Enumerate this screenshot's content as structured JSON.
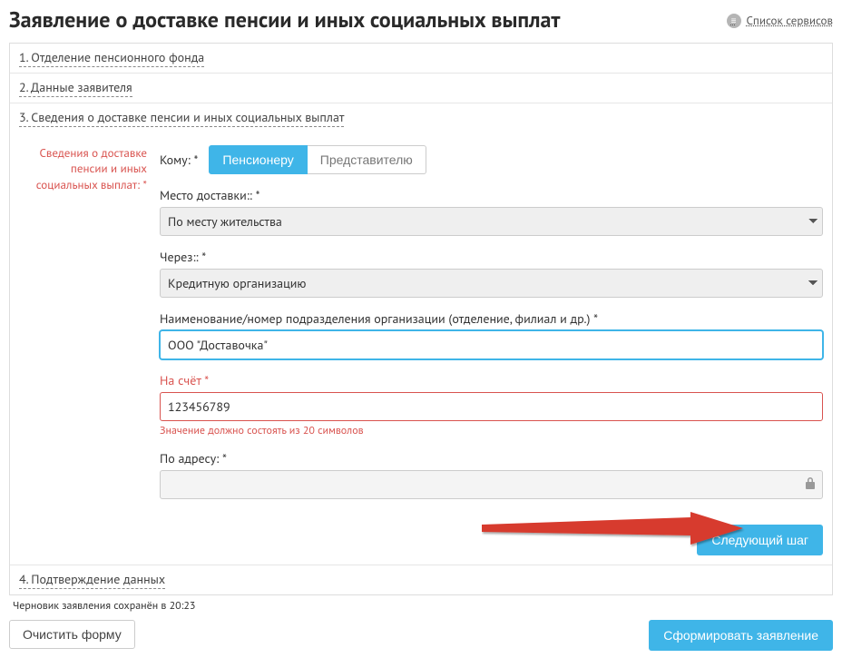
{
  "header": {
    "title": "Заявление о доставке пенсии и иных социальных выплат",
    "serviceListLabel": "Список сервисов"
  },
  "steps": {
    "s1": "1. Отделение пенсионного фонда",
    "s2": "2. Данные заявителя",
    "s3": "3. Сведения о доставке пенсии и иных социальных выплат",
    "s4": "4. Подтверждение данных"
  },
  "sideLabel": "Сведения о доставке пенсии и иных социальных выплат: *",
  "form": {
    "whoLabel": "Кому: *",
    "whoPensioner": "Пенсионеру",
    "whoRepresentative": "Представителю",
    "placeLabel": "Место доставки:: *",
    "placeValue": "По месту жительства",
    "viaLabel": "Через:: *",
    "viaValue": "Кредитную организацию",
    "orgLabel": "Наименование/номер подразделения организации (отделение, филиал и др.) *",
    "orgValue": "ООО \"Доставочка\"",
    "accountLabel": "На счёт *",
    "accountValue": "123456789",
    "accountError": "Значение должно состоять из 20 символов",
    "addressLabel": "По адресу: *",
    "addressValue": ""
  },
  "buttons": {
    "next": "Следующий шаг",
    "clear": "Очистить форму",
    "submit": "Сформировать заявление"
  },
  "draftNote": "Черновик заявления сохранён в 20:23"
}
